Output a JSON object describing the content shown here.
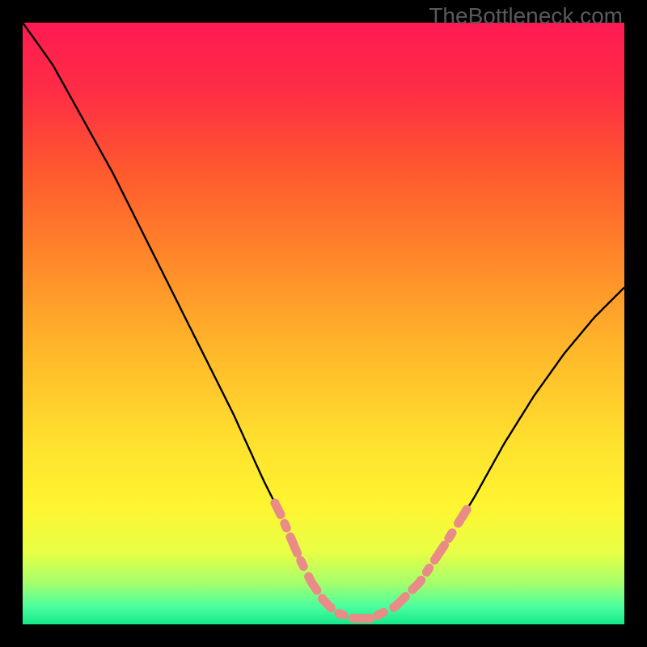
{
  "watermark": "TheBottleneck.com",
  "gradient": {
    "stops": [
      {
        "offset": 0.0,
        "color": "#ff1a52"
      },
      {
        "offset": 0.12,
        "color": "#ff2e44"
      },
      {
        "offset": 0.25,
        "color": "#ff5a2e"
      },
      {
        "offset": 0.4,
        "color": "#ff8a2a"
      },
      {
        "offset": 0.55,
        "color": "#ffb92a"
      },
      {
        "offset": 0.7,
        "color": "#ffe12e"
      },
      {
        "offset": 0.8,
        "color": "#fff430"
      },
      {
        "offset": 0.88,
        "color": "#e8ff45"
      },
      {
        "offset": 0.93,
        "color": "#a8ff6a"
      },
      {
        "offset": 0.97,
        "color": "#4cff9e"
      },
      {
        "offset": 1.0,
        "color": "#14e88a"
      }
    ]
  },
  "chart_data": {
    "type": "line",
    "title": "",
    "xlabel": "",
    "ylabel": "",
    "xlim": [
      0,
      100
    ],
    "ylim": [
      0,
      100
    ],
    "series": [
      {
        "name": "curve",
        "x": [
          0,
          5,
          10,
          15,
          20,
          25,
          30,
          35,
          40,
          43,
          46,
          48,
          50,
          52,
          55,
          58,
          62,
          66,
          70,
          75,
          80,
          85,
          90,
          95,
          100
        ],
        "y": [
          100,
          93,
          84,
          75,
          65,
          55,
          45,
          35,
          24,
          18,
          11,
          7,
          4,
          2,
          1,
          1,
          3,
          7,
          13,
          21,
          30,
          38,
          45,
          51,
          56
        ]
      }
    ],
    "highlight_band": {
      "y_from": 0,
      "y_to": 20
    },
    "dash_segments": [
      {
        "x_range": [
          36,
          40
        ],
        "above_min": false
      },
      {
        "x_range": [
          62,
          66
        ],
        "above_min": false
      }
    ]
  }
}
